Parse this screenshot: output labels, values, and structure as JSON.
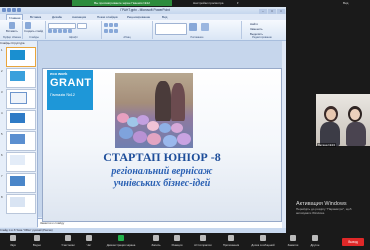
{
  "zoom": {
    "screen_banner": "Вы просматриваете экран Гімназія №12",
    "view_options": "Настройки просмотра",
    "view_label": "Вид",
    "toolbar": [
      {
        "label": "Звук",
        "icon": "microphone-icon"
      },
      {
        "label": "Видео",
        "icon": "camera-icon"
      },
      {
        "label": "Участники",
        "icon": "participants-icon"
      },
      {
        "label": "Чат",
        "icon": "chat-icon"
      },
      {
        "label": "Демонстрация экрана",
        "icon": "share-screen-icon"
      },
      {
        "label": "Запись",
        "icon": "record-icon"
      },
      {
        "label": "Реакции",
        "icon": "reactions-icon"
      },
      {
        "label": "AI Companion",
        "icon": "ai-icon"
      },
      {
        "label": "Приложения",
        "icon": "apps-icon"
      },
      {
        "label": "Доска сообщений",
        "icon": "whiteboard-icon"
      },
      {
        "label": "Заметки",
        "icon": "notes-icon"
      },
      {
        "label": "Другое",
        "icon": "more-icon"
      }
    ],
    "end_label": "Выход",
    "participant_name": "Тетяна №13",
    "activation": {
      "title": "Активация Windows",
      "line1": "Перейдіть до розділу \"Параметри\", щоб",
      "line2": "активувати Windows."
    }
  },
  "powerpoint": {
    "window_title": "ГРАНТ.pptx - Microsoft PowerPoint",
    "tabs": [
      "Главная",
      "Вставка",
      "Дизайн",
      "Анимация",
      "Показ слайдов",
      "Рецензирование",
      "Вид"
    ],
    "active_tab": "Главная",
    "ribbon": {
      "clipboard": "Буфер обмена",
      "paste": "Вставить",
      "slides": "Слайды",
      "new_slide": "Создать слайд",
      "font": "Шрифт",
      "paragraph": "Абзац",
      "drawing": "Рисование",
      "editing": "Редактирование",
      "find": "Найти",
      "replace": "Заменить",
      "select": "Выделить"
    },
    "panel_tabs": "Слайды  Структура",
    "slide_count": 8,
    "selected_slide": 1,
    "notes_placeholder": "Заметки к слайду",
    "status": "Слайд 1 из 8   Тема \"Office\"   русский (Россия)"
  },
  "slide": {
    "logo_eco": "eco work",
    "logo_grant": "GRANT",
    "logo_sub": "Гімназія №12",
    "title_line1": "СТАРТАП ЮНІОР -8",
    "title_line2": "регіональний  вернісаж",
    "title_line3": "учнівських бізнес-ідей"
  },
  "colors": {
    "zoom_green": "#2d8c3c",
    "slide_title": "#1e4e9a",
    "slide_subtitle": "#2a60b3",
    "logo_blue": "#1e97d8",
    "end_red": "#e02828"
  }
}
